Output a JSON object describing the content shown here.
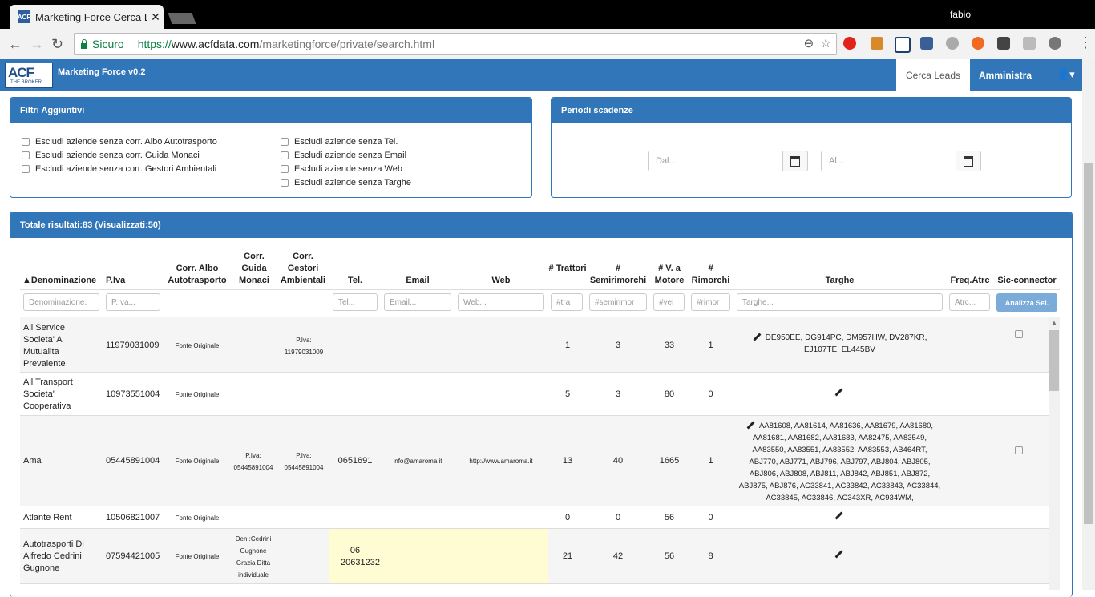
{
  "browser": {
    "tab_title": "Marketing Force Cerca Le",
    "favicon_text": "ACF",
    "user": "fabio",
    "secure_label": "Sicuro",
    "url_scheme": "https://",
    "url_host": "www.acfdata.com",
    "url_path": "/marketingforce/private/search.html"
  },
  "app": {
    "logo_text": "ACF",
    "logo_sub": "THE BROKER",
    "brand": "Marketing Force v0.2",
    "nav": [
      "Cerca Leads",
      "Amministra"
    ]
  },
  "filters": {
    "title": "Filtri Aggiuntivi",
    "left": [
      "Escludi aziende senza corr. Albo Autotrasporto",
      "Escludi aziende senza corr. Guida Monaci",
      "Escludi aziende senza corr. Gestori Ambientali"
    ],
    "right": [
      "Escludi aziende senza Tel.",
      "Escludi aziende senza Email",
      "Escludi aziende senza Web",
      "Escludi aziende senza Targhe"
    ]
  },
  "periods": {
    "title": "Periodi scadenze",
    "from_placeholder": "Dal...",
    "to_placeholder": "Al..."
  },
  "results": {
    "title": "Totale risultati:83 (Visualizzati:50)",
    "headers": {
      "denominazione": "▲Denominazione",
      "piva": "P.Iva",
      "albo": "Corr. Albo Autotrasporto",
      "guida": "Corr. Guida Monaci",
      "gestori": "Corr. Gestori Ambientali",
      "tel": "Tel.",
      "email": "Email",
      "web": "Web",
      "trattori": "# Trattori",
      "semirimorchi": "# Semirimorchi",
      "motore": "# V. a Motore",
      "rimorchi": "# Rimorchi",
      "targhe": "Targhe",
      "freq": "Freq.Atrc",
      "sic": "Sic-connector"
    },
    "filter_placeholders": {
      "denominazione": "Denominazione.",
      "piva": "P.Iva...",
      "tel": "Tel...",
      "email": "Email...",
      "web": "Web...",
      "trattori": "#tra",
      "semirimorchi": "#semirimor",
      "motore": "#vei",
      "rimorchi": "#rimor",
      "targhe": "Targhe...",
      "freq": "Atrc..."
    },
    "analyze_button": "Analizza Sel.",
    "rows": [
      {
        "name": "All Service Societa' A Mutualita Prevalente",
        "piva": "11979031009",
        "albo": "Fonte Originale",
        "guida": "",
        "gestori": "P.Iva: 11979031009",
        "tel": "",
        "email": "",
        "web": "",
        "trattori": "1",
        "semirimorchi": "3",
        "motore": "33",
        "rimorchi": "1",
        "targhe": "DE950EE, DG914PC, DM957HW, DV287KR, EJ107TE, EL445BV"
      },
      {
        "name": "All Transport Societa' Cooperativa",
        "piva": "10973551004",
        "albo": "Fonte Originale",
        "guida": "",
        "gestori": "",
        "tel": "",
        "email": "",
        "web": "",
        "trattori": "5",
        "semirimorchi": "3",
        "motore": "80",
        "rimorchi": "0",
        "targhe": ""
      },
      {
        "name": "Ama",
        "piva": "05445891004",
        "albo": "Fonte Originale",
        "guida": "P.Iva: 05445891004",
        "gestori": "P.Iva: 05445891004",
        "tel": "0651691",
        "email": "info@amaroma.it",
        "web": "http://www.amaroma.it",
        "trattori": "13",
        "semirimorchi": "40",
        "motore": "1665",
        "rimorchi": "1",
        "targhe": "AA81608, AA81614, AA81636, AA81679, AA81680, AA81681, AA81682, AA81683, AA82475, AA83549, AA83550, AA83551, AA83552, AA83553, AB464RT, ABJ770, ABJ771, ABJ796, ABJ797, ABJ804, ABJ805, ABJ806, ABJ808, ABJ811, ABJ842, ABJ851, ABJ872, ABJ875, ABJ876, AC33841, AC33842, AC33843, AC33844, AC33845, AC33846, AC343XR, AC934WM,"
      },
      {
        "name": "Atlante Rent",
        "piva": "10506821007",
        "albo": "Fonte Originale",
        "guida": "",
        "gestori": "",
        "tel": "",
        "email": "",
        "web": "",
        "trattori": "0",
        "semirimorchi": "0",
        "motore": "56",
        "rimorchi": "0",
        "targhe": ""
      },
      {
        "name": "Autotrasporti Di Alfredo Cedrini Gugnone",
        "piva": "07594421005",
        "albo": "Fonte Originale",
        "guida": "Den.:Cedrini Gugnone Grazia Ditta individuale",
        "gestori": "",
        "tel": "06 20631232",
        "email": "",
        "web": "",
        "trattori": "21",
        "semirimorchi": "42",
        "motore": "56",
        "rimorchi": "8",
        "targhe": ""
      }
    ]
  }
}
